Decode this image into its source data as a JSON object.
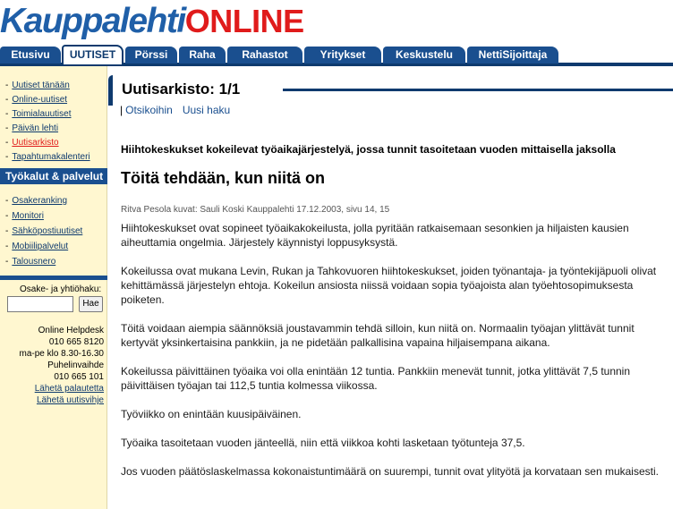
{
  "logo": {
    "main": "Kauppalehti",
    "online": "ONLINE"
  },
  "tabs": [
    {
      "label": "Etusivu",
      "active": false
    },
    {
      "label": "UUTISET",
      "active": true
    },
    {
      "label": "Pörssi",
      "active": false
    },
    {
      "label": "Raha",
      "active": false
    },
    {
      "label": "Rahastot",
      "active": false
    },
    {
      "label": "Yritykset",
      "active": false
    },
    {
      "label": "Keskustelu",
      "active": false
    },
    {
      "label": "NettiSijoittaja",
      "active": false
    }
  ],
  "sidebar": {
    "news_items": [
      {
        "label": "Uutiset tänään"
      },
      {
        "label": "Online-uutiset"
      },
      {
        "label": "Toimialauutiset"
      },
      {
        "label": "Päivän lehti"
      },
      {
        "label": "Uutisarkisto",
        "current": true
      },
      {
        "label": "Tapahtumakalenteri"
      }
    ],
    "tools_header": "Työkalut & palvelut",
    "tool_items": [
      {
        "label": "Osakeranking"
      },
      {
        "label": "Monitori"
      },
      {
        "label": "Sähköpostiuutiset"
      },
      {
        "label": "Mobiilipalvelut"
      },
      {
        "label": "Talousnero"
      }
    ],
    "search_label": "Osake- ja yhtiöhaku:",
    "search_value": "",
    "search_button": "Hae",
    "helpdesk": {
      "line1": "Online Helpdesk",
      "line2": "010 665 8120",
      "line3": "ma-pe klo 8.30-16.30",
      "line4": "Puhelinvaihde",
      "line5": "010 665 101",
      "feedback_link": "Lähetä palautetta",
      "tip_link": "Lähetä uutisvihje"
    }
  },
  "archive": {
    "title": "Uutisarkisto: 1/1",
    "pipe": "|",
    "link_headlines": "Otsikoihin",
    "link_new_search": "Uusi haku"
  },
  "article": {
    "lead": "Hiihtokeskukset kokeilevat työaikajärjestelyä, jossa tunnit tasoitetaan vuoden mittaisella jaksolla",
    "headline": "Töitä tehdään, kun niitä on",
    "byline": "Ritva Pesola kuvat: Sauli Koski Kauppalehti 17.12.2003, sivu 14, 15",
    "paragraphs": [
      "Hiihtokeskukset ovat sopineet työaikakokeilusta, jolla pyritään ratkaisemaan sesonkien ja hiljaisten kausien aiheuttamia ongelmia. Järjestely käynnistyi loppusyksystä.",
      "Kokeilussa ovat mukana Levin, Rukan ja Tahkovuoren hiihtokeskukset, joiden työnantaja- ja työntekijäpuoli olivat kehittämässä järjestelyn ehtoja. Kokeilun ansiosta niissä voidaan sopia työajoista alan työehtosopimuksesta poiketen.",
      "Töitä voidaan aiempia säännöksiä joustavammin tehdä silloin, kun niitä on. Normaalin työajan ylittävät tunnit kertyvät yksinkertaisina pankkiin, ja ne pidetään palkallisina vapaina hiljaisempana aikana.",
      "Kokeilussa päivittäinen työaika voi olla enintään 12 tuntia. Pankkiin menevät tunnit, jotka ylittävät 7,5 tunnin päivittäisen työajan tai 112,5 tuntia kolmessa viikossa.",
      "Työviikko on enintään kuusipäiväinen.",
      "Työaika tasoitetaan vuoden jänteellä, niin että viikkoa kohti lasketaan työtunteja 37,5.",
      "Jos vuoden päätöslaskelmassa kokonaistuntimäärä on suurempi, tunnit ovat ylityötä ja korvataan sen mukaisesti."
    ]
  },
  "colors": {
    "brand_blue": "#1a4f8f",
    "brand_navy": "#0e3a6e",
    "brand_red": "#e01b1b",
    "sidebar_bg": "#fff7d0"
  }
}
